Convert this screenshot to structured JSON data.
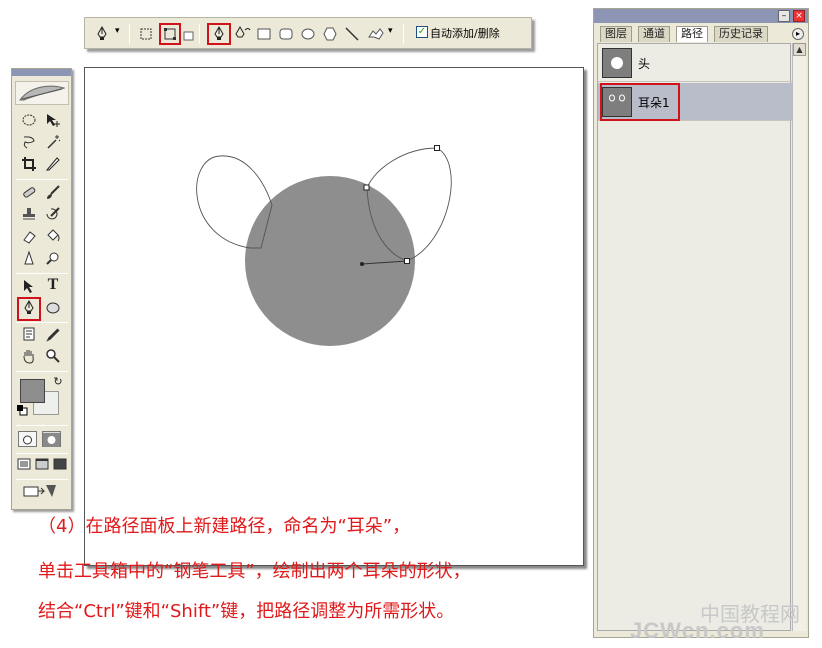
{
  "options_bar": {
    "pen_icon": "pen-tool-icon",
    "auto_add_delete_label": "自动添加/删除",
    "auto_add_delete_checked": true
  },
  "panel": {
    "tabs": [
      "图层",
      "通道",
      "路径",
      "历史记录"
    ],
    "active_tab": "路径",
    "paths": [
      {
        "name": "头",
        "selected": false
      },
      {
        "name": "耳朵1",
        "selected": true
      }
    ]
  },
  "toolbox": {
    "selected_tool": "pen-tool-icon",
    "text_tool_label": "T"
  },
  "caption": {
    "line1": "（4）在路径面板上新建路径，命名为“耳朵”，",
    "line2": "单击工具箱中的“钢笔工具”，绘制出两个耳朵的形状，",
    "line3": "结合“Ctrl”键和“Shift”键，把路径调整为所需形状。"
  },
  "watermark": {
    "cn": "中国教程网",
    "en": "JCWcn.com"
  },
  "colors": {
    "highlight": "#d0121b",
    "circle": "#8e8e8e",
    "caption": "#e0191a",
    "foreground": "#8d8d8d"
  }
}
